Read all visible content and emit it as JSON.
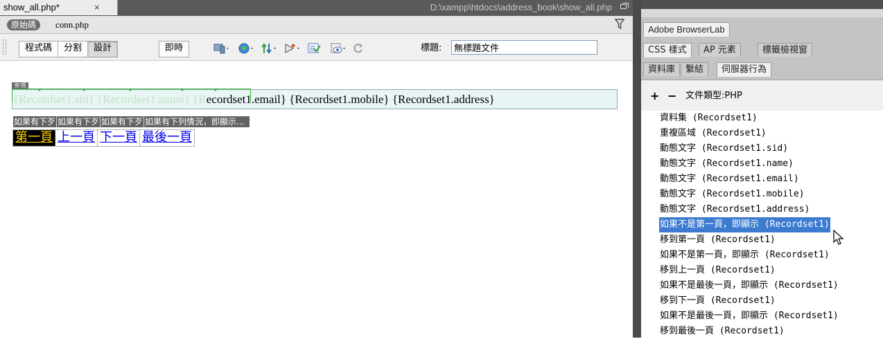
{
  "document": {
    "tab_title": "show_all.php*",
    "tab_close": "×",
    "path": "D:\\xampp\\htdocs\\address_book\\show_all.php",
    "source_pill": "原始碼",
    "related_file": "conn.php",
    "view_buttons": [
      "程式碼",
      "分割",
      "設計"
    ],
    "live_button": "即時",
    "title_label": "標題:",
    "title_value": "無標題文件"
  },
  "canvas": {
    "repeat_tab": "重複",
    "record_ghost": "{Recordset1.sid} {Recordset1.name} {R",
    "record_text": "ecordset1.email} {Recordset1.mobile} {Recordset1.address}",
    "conditions": [
      "如果有下歹",
      "如果有下歹",
      "如果有下歹",
      "如果有下列情況，即顯示..."
    ],
    "nav": [
      "第一頁",
      "上一頁",
      "下一頁",
      "最後一頁"
    ]
  },
  "panels": {
    "browserlab_tab": "Adobe BrowserLab",
    "css_tabs": [
      "CSS 樣式",
      "AP 元素",
      "標籤檢視窗"
    ],
    "db_tabs": [
      "資料庫",
      "繫結",
      "伺服器行為"
    ],
    "plus": "+",
    "minus": "−",
    "doctype": "文件類型:PHP",
    "behaviors": [
      "資料集 (Recordset1)",
      "重複區域 (Recordset1)",
      "動態文字 (Recordset1.sid)",
      "動態文字 (Recordset1.name)",
      "動態文字 (Recordset1.email)",
      "動態文字 (Recordset1.mobile)",
      "動態文字 (Recordset1.address)",
      "如果不是第一頁，即顯示 (Recordset1)",
      "移到第一頁 (Recordset1)",
      "如果不是第一頁，即顯示 (Recordset1)",
      "移到上一頁 (Recordset1)",
      "如果不是最後一頁，即顯示 (Recordset1)",
      "移到下一頁 (Recordset1)",
      "如果不是最後一頁，即顯示 (Recordset1)",
      "移到最後一頁 (Recordset1)"
    ],
    "selected_behavior_index": 7
  },
  "icons": [
    "restore-window-icon",
    "filter-icon",
    "multiscreen-icon",
    "preview-browser-icon",
    "file-management-icon",
    "debug-icon",
    "check-page-icon",
    "visual-aids-icon",
    "refresh-icon",
    "mouse-cursor-icon"
  ],
  "colors": {
    "selection": "#3c7bd0",
    "dark_chrome": "#5a5a5a",
    "link": "#0000ee",
    "active_nav_bg": "#000000",
    "active_nav_text": "#ffd200"
  }
}
